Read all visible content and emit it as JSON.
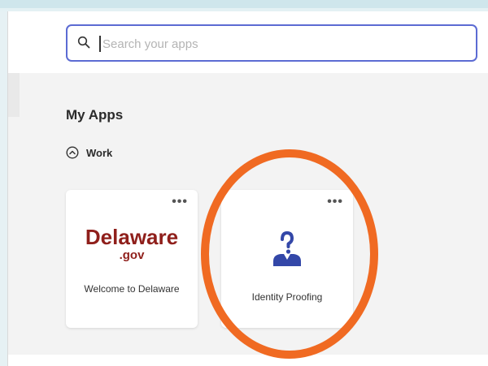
{
  "search": {
    "placeholder": "Search your apps",
    "value": ""
  },
  "section": {
    "title": "My Apps"
  },
  "group": {
    "label": "Work",
    "toggle_icon": "chevron-up-circle-icon"
  },
  "apps": [
    {
      "logo_main": "Delaware",
      "logo_sub": ".gov",
      "label": "Welcome to Delaware",
      "menu_icon": "more-horizontal-icon"
    },
    {
      "icon": "identity-proofing-icon",
      "label": "Identity Proofing",
      "menu_icon": "more-horizontal-icon"
    }
  ],
  "colors": {
    "accent": "#5c6bd3",
    "delaware_red": "#8f1f1b",
    "identity_blue": "#3347a8",
    "annotation_orange": "#f06a22"
  }
}
